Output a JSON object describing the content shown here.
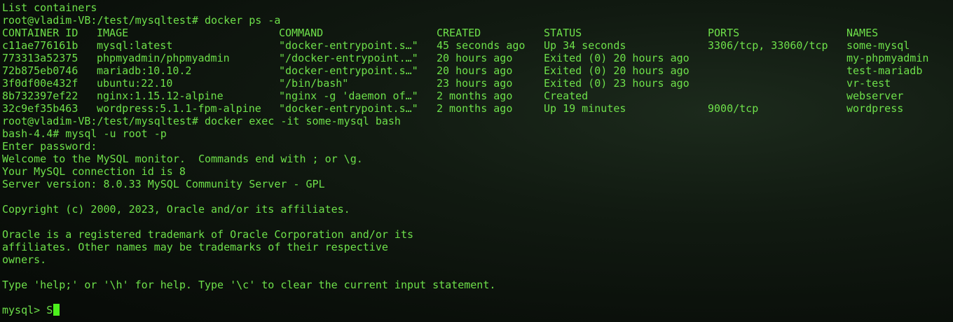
{
  "terminal": {
    "lines_top": [
      "List containers",
      "root@vladim-VB:/test/mysqltest# docker ps -a"
    ],
    "table": {
      "headers": [
        "CONTAINER ID",
        "IMAGE",
        "COMMAND",
        "CREATED",
        "STATUS",
        "PORTS",
        "NAMES"
      ],
      "rows": [
        [
          "c11ae776161b",
          "mysql:latest",
          "\"docker-entrypoint.s…\"",
          "45 seconds ago",
          "Up 34 seconds",
          "3306/tcp, 33060/tcp",
          "some-mysql"
        ],
        [
          "773313a52375",
          "phpmyadmin/phpmyadmin",
          "\"/docker-entrypoint.…\"",
          "20 hours ago",
          "Exited (0) 20 hours ago",
          "",
          "my-phpmyadmin"
        ],
        [
          "72b875eb0746",
          "mariadb:10.10.2",
          "\"docker-entrypoint.s…\"",
          "20 hours ago",
          "Exited (0) 20 hours ago",
          "",
          "test-mariadb"
        ],
        [
          "3f0df00e432f",
          "ubuntu:22.10",
          "\"/bin/bash\"",
          "23 hours ago",
          "Exited (0) 23 hours ago",
          "",
          "vr-test"
        ],
        [
          "8b732397ef22",
          "nginx:1.15.12-alpine",
          "\"nginx -g 'daemon of…\"",
          "2 months ago",
          "Created",
          "",
          "webserver"
        ],
        [
          "32c9ef35b463",
          "wordpress:5.1.1-fpm-alpine",
          "\"docker-entrypoint.s…\"",
          "2 months ago",
          "Up 19 minutes",
          "9000/tcp",
          "wordpress"
        ]
      ]
    },
    "lines_bottom": [
      "root@vladim-VB:/test/mysqltest# docker exec -it some-mysql bash",
      "bash-4.4# mysql -u root -p",
      "Enter password:",
      "Welcome to the MySQL monitor.  Commands end with ; or \\g.",
      "Your MySQL connection id is 8",
      "Server version: 8.0.33 MySQL Community Server - GPL",
      "",
      "Copyright (c) 2000, 2023, Oracle and/or its affiliates.",
      "",
      "Oracle is a registered trademark of Oracle Corporation and/or its",
      "affiliates. Other names may be trademarks of their respective",
      "owners.",
      "",
      "Type 'help;' or '\\h' for help. Type '\\c' to clear the current input statement.",
      ""
    ],
    "prompt": {
      "label": "mysql> ",
      "input": "S"
    },
    "colors": {
      "text": "#6ee04a",
      "cursor": "#4cf01c",
      "background": "#0d120d"
    }
  }
}
